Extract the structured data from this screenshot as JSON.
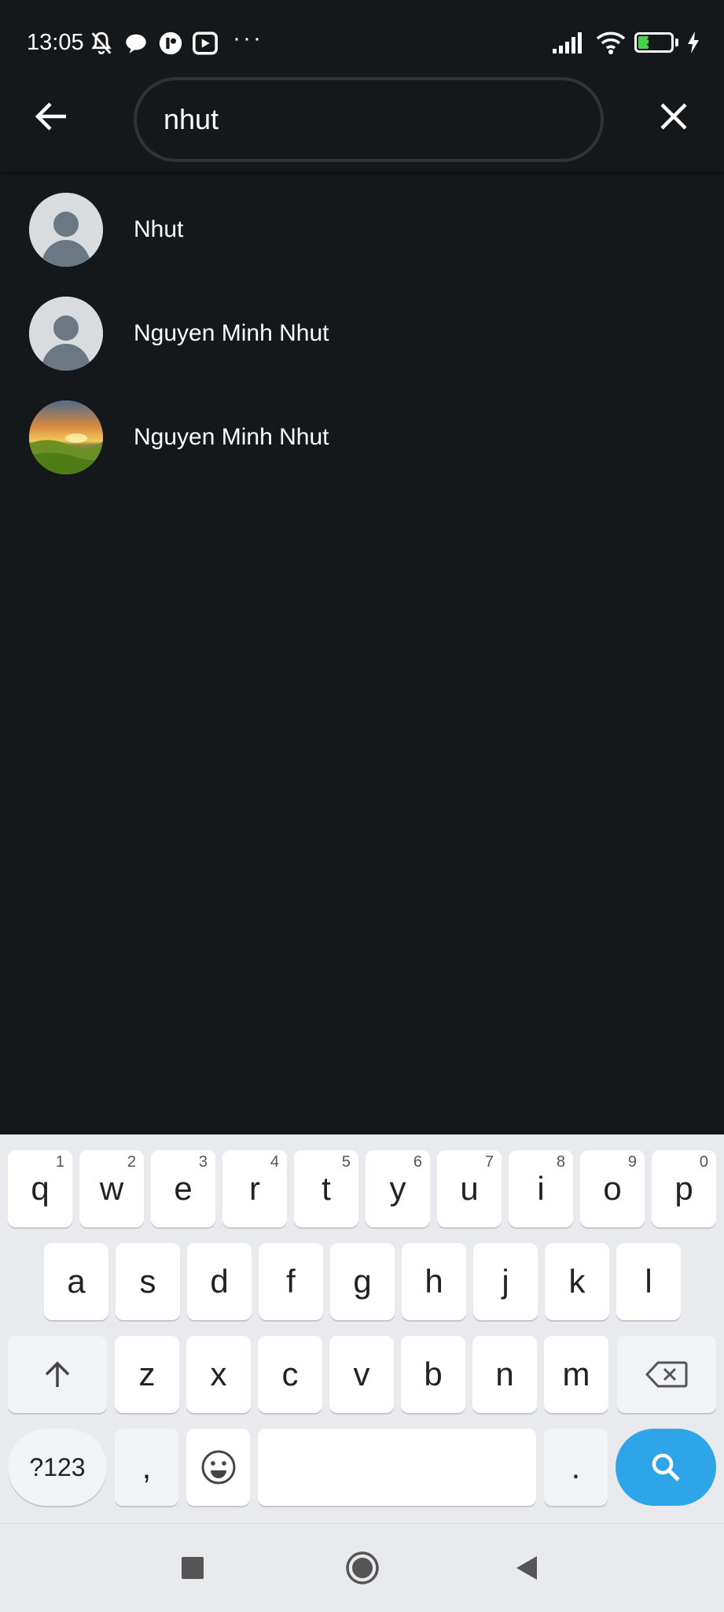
{
  "status_bar": {
    "time": "13:05",
    "battery_level": "31",
    "overflow": "···",
    "icons": [
      "bell-off-icon",
      "chat-bubble-icon",
      "app-icon",
      "youtube-icon",
      "signal-icon",
      "wifi-icon",
      "battery-icon",
      "charging-icon"
    ]
  },
  "search": {
    "value": "nhut"
  },
  "results": [
    {
      "name": "Nhut",
      "avatar": "default-avatar"
    },
    {
      "name": "Nguyen Minh Nhut",
      "avatar": "default-avatar"
    },
    {
      "name": "Nguyen Minh Nhut",
      "avatar": "photo-avatar"
    }
  ],
  "keyboard": {
    "row1": [
      {
        "k": "q",
        "n": "1"
      },
      {
        "k": "w",
        "n": "2"
      },
      {
        "k": "e",
        "n": "3"
      },
      {
        "k": "r",
        "n": "4"
      },
      {
        "k": "t",
        "n": "5"
      },
      {
        "k": "y",
        "n": "6"
      },
      {
        "k": "u",
        "n": "7"
      },
      {
        "k": "i",
        "n": "8"
      },
      {
        "k": "o",
        "n": "9"
      },
      {
        "k": "p",
        "n": "0"
      }
    ],
    "row2": [
      "a",
      "s",
      "d",
      "f",
      "g",
      "h",
      "j",
      "k",
      "l"
    ],
    "row3": [
      "z",
      "x",
      "c",
      "v",
      "b",
      "n",
      "m"
    ],
    "symbols_label": "?123",
    "comma": ",",
    "period": "."
  },
  "colors": {
    "background": "#15181b",
    "keyboard": "#e9eaed",
    "accent": "#2ea5e8"
  }
}
